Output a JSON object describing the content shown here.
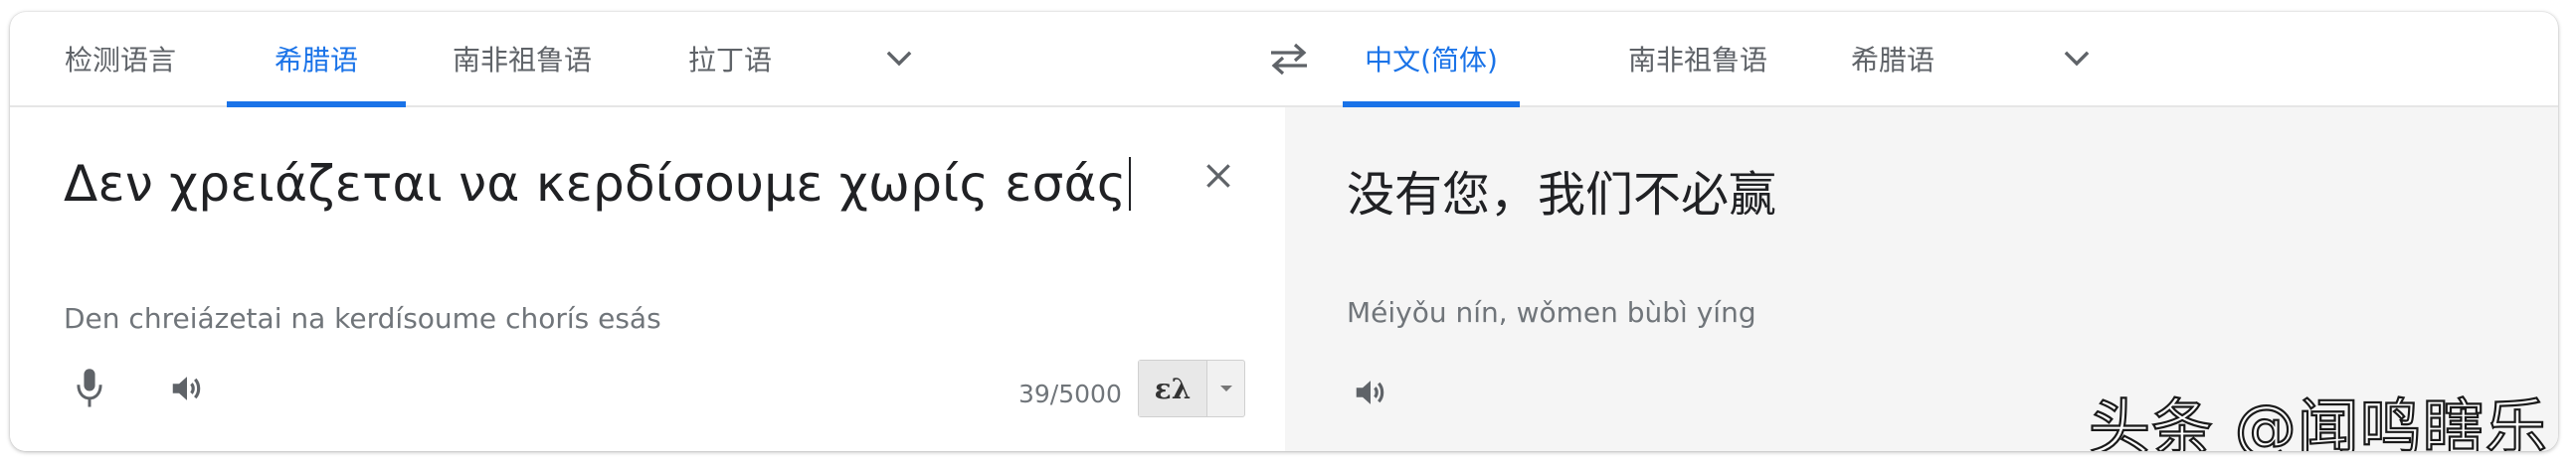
{
  "source_tabs": {
    "items": [
      {
        "label": "检测语言"
      },
      {
        "label": "希腊语"
      },
      {
        "label": "南非祖鲁语"
      },
      {
        "label": "拉丁语"
      }
    ],
    "active_index": 1
  },
  "target_tabs": {
    "items": [
      {
        "label": "中文(简体)"
      },
      {
        "label": "南非祖鲁语"
      },
      {
        "label": "希腊语"
      }
    ],
    "active_index": 0
  },
  "source": {
    "text": "Δεν χρειάζεται να κερδίσουμε χωρίς εσάς",
    "romanization": "Den chreiázetai na kerdísoume chorís esás",
    "char_count": "39/5000",
    "keyboard_label": "ελ"
  },
  "target": {
    "text": "没有您，我们不必赢",
    "romanization": "Méiyǒu nín, wǒmen bùbì yíng"
  },
  "watermark": "头条 @闻鸣瞎乐",
  "colors": {
    "accent": "#1a73e8",
    "text_primary": "#202124",
    "text_secondary": "#5f6368",
    "panel_bg": "#f5f5f5"
  },
  "icons": {
    "source_more": "chevron-down-icon",
    "swap": "swap-languages-icon",
    "target_more": "chevron-down-icon",
    "clear": "close-icon",
    "mic": "microphone-icon",
    "listen_source": "speaker-icon",
    "listen_target": "speaker-icon",
    "keyboard_dropdown": "caret-down-icon"
  }
}
